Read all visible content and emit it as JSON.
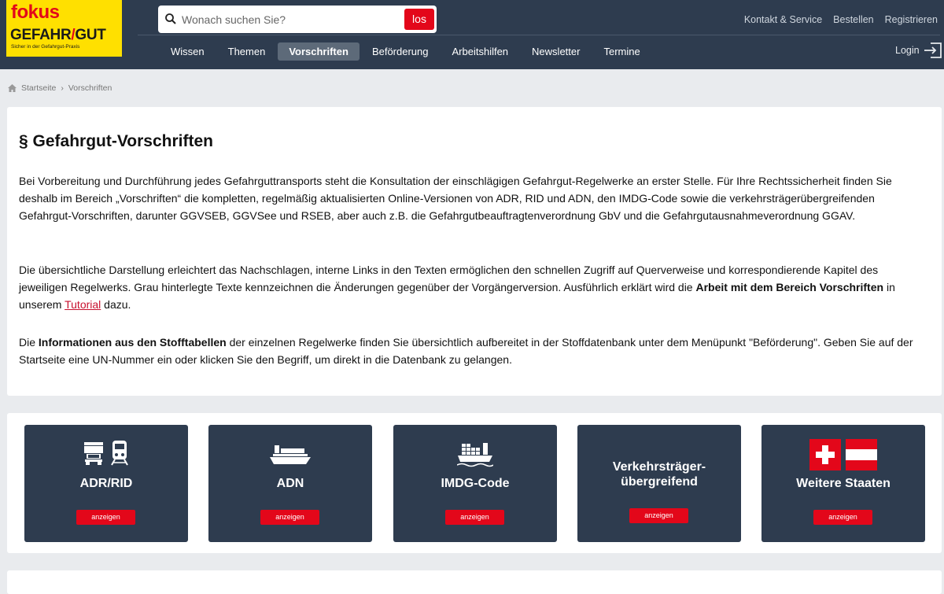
{
  "logo": {
    "line1": "fokus",
    "line2_a": "GEFAHR",
    "line2_slash": "/",
    "line2_b": "GUT",
    "tagline": "Sicher in der Gefahrgut-Praxis"
  },
  "search": {
    "placeholder": "Wonach suchen Sie?",
    "button": "los"
  },
  "toplinks": [
    "Kontakt & Service",
    "Bestellen",
    "Registrieren"
  ],
  "nav": [
    "Wissen",
    "Themen",
    "Vorschriften",
    "Beförderung",
    "Arbeitshilfen",
    "Newsletter",
    "Termine"
  ],
  "login": "Login",
  "breadcrumb": {
    "home": "Startseite",
    "sep": "›",
    "current": "Vorschriften"
  },
  "content": {
    "title": "§ Gefahrgut-Vorschriften",
    "p1": "Bei Vorbereitung und Durchführung jedes Gefahrguttransports steht die Konsultation der einschlägigen Gefahrgut-Regelwerke an erster Stelle. Für Ihre Rechtssicherheit finden Sie deshalb im Bereich „Vorschriften“ die kompletten, regelmäßig aktualisierten Online-Versionen von ADR, RID und ADN, den IMDG-Code sowie die verkehrsträgerübergreifenden Gefahrgut-Vorschriften, darunter GGVSEB, GGVSee und RSEB, aber auch z.B. die Gefahrgutbeauftragtenverordnung GbV und die Gefahrgutausnahmeverordnung GGAV.",
    "p2_a": "Die übersichtliche Darstellung erleichtert das Nachschlagen, interne Links in den Texten ermöglichen den schnellen Zugriff auf Querverweise und korrespondierende Kapitel des jeweiligen Regelwerks. Grau hinterlegte Texte kennzeichnen die Änderungen gegenüber der Vorgängerversion. Ausführlich erklärt wird die ",
    "p2_bold": "Arbeit mit dem Bereich Vorschriften",
    "p2_b": " in unserem ",
    "p2_link": "Tutorial",
    "p2_c": " dazu.",
    "p3_a": "Die ",
    "p3_bold": "Informationen aus den Stofftabellen",
    "p3_b": " der einzelnen Regelwerke finden Sie übersichtlich aufbereitet in der Stoffdatenbank unter dem Menüpunkt \"Beförderung\". Geben Sie auf der Startseite eine UN-Nummer ein oder klicken Sie den Begriff, um direkt in die Datenbank zu gelangen."
  },
  "tiles": [
    {
      "title": "ADR/RID",
      "button": "anzeigen",
      "icon": "truck-train-icon"
    },
    {
      "title": "ADN",
      "button": "anzeigen",
      "icon": "ship-icon"
    },
    {
      "title": "IMDG-Code",
      "button": "anzeigen",
      "icon": "container-ship-icon"
    },
    {
      "title_line1": "Verkehrsträger-",
      "title_line2": "übergreifend",
      "button": "anzeigen"
    },
    {
      "title": "Weitere Staaten",
      "button": "anzeigen",
      "icon": "flags-icon"
    }
  ],
  "colors": {
    "header": "#2e3c4f",
    "accent": "#e3071a",
    "logo_bg": "#ffe000"
  }
}
